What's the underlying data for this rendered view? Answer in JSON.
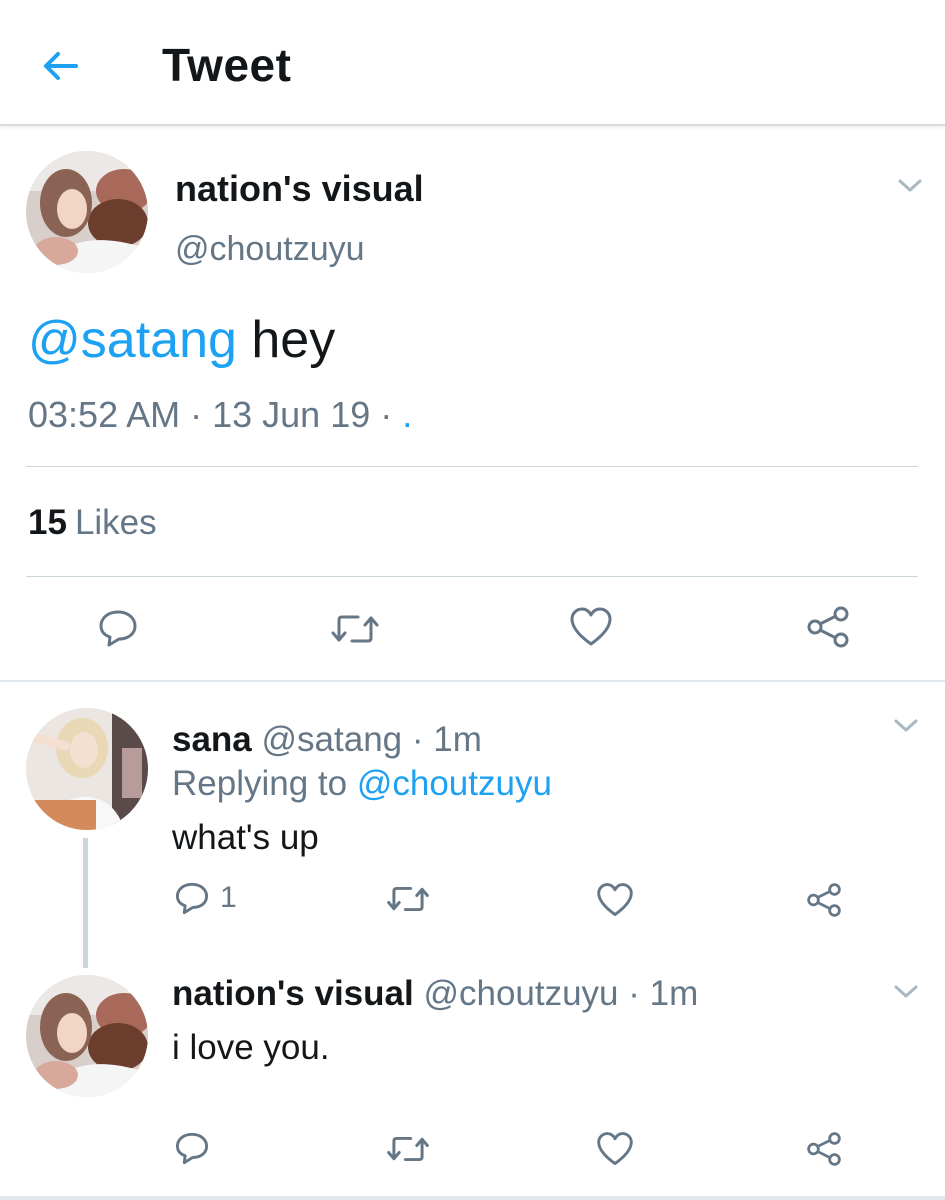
{
  "header": {
    "title": "Tweet",
    "back_icon": "arrow-left-icon"
  },
  "colors": {
    "accent": "#1da1f2",
    "text": "#14171a",
    "muted": "#657786",
    "divider": "#ccd6dd"
  },
  "main_tweet": {
    "display_name": "nation's visual",
    "handle": "@choutzuyu",
    "mention": "@satang",
    "text": " hey",
    "time": "03:52 AM",
    "sep1": " · ",
    "date": "13 Jun 19",
    "sep2": " · ",
    "trail": ".",
    "likes_count": "15",
    "likes_label": "Likes"
  },
  "replies": [
    {
      "display_name": "sana",
      "handle": " @satang",
      "time": " · 1m",
      "replying_prefix": "Replying to ",
      "replying_to": "@choutzuyu",
      "text": "what's up",
      "reply_count": "1"
    },
    {
      "display_name": "nation's visual",
      "handle": " @choutzuyu",
      "time": " · 1m",
      "text": "i love you."
    }
  ]
}
